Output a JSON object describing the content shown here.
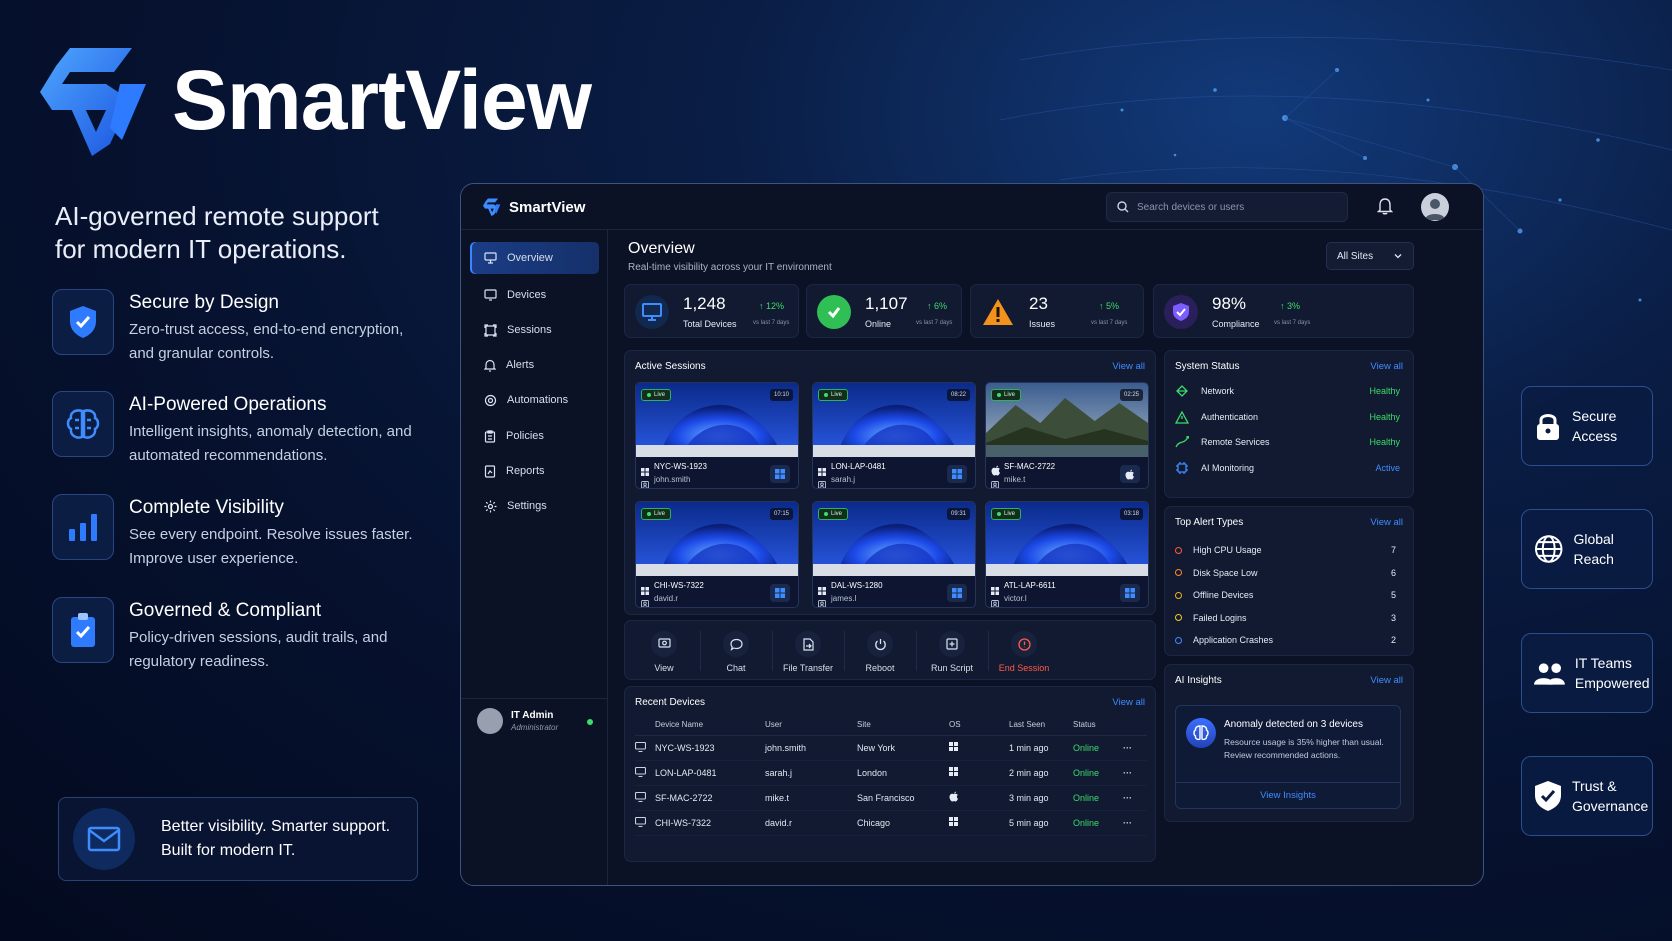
{
  "brand": {
    "name": "SmartView",
    "tagline": "AI-governed remote support for modern IT operations."
  },
  "features": [
    {
      "title": "Secure by Design",
      "desc": "Zero-trust access, end-to-end encryption, and granular controls.",
      "icon": "shield-check-icon"
    },
    {
      "title": "AI-Powered Operations",
      "desc": "Intelligent insights, anomaly detection, and automated recommendations.",
      "icon": "brain-icon"
    },
    {
      "title": "Complete Visibility",
      "desc": "See every endpoint. Resolve issues faster. Improve user experience.",
      "icon": "bar-chart-icon"
    },
    {
      "title": "Governed & Compliant",
      "desc": "Policy-driven sessions, audit trails, and regulatory readiness.",
      "icon": "clipboard-check-icon"
    }
  ],
  "footer": {
    "line1": "Better visibility. Smarter support.",
    "line2": "Built for modern IT."
  },
  "side_cards": [
    {
      "line1": "Secure",
      "line2": "Access",
      "icon": "lock-icon"
    },
    {
      "line1": "Global",
      "line2": "Reach",
      "icon": "globe-icon"
    },
    {
      "line1": "IT Teams",
      "line2": "Empowered",
      "icon": "users-icon"
    },
    {
      "line1": "Trust &",
      "line2": "Governance",
      "icon": "shield-check-icon"
    }
  ],
  "app": {
    "name": "SmartView",
    "search_placeholder": "Search devices or users",
    "nav": [
      {
        "label": "Overview",
        "icon": "monitor-icon",
        "active": true
      },
      {
        "label": "Devices",
        "icon": "devices-icon"
      },
      {
        "label": "Sessions",
        "icon": "sessions-icon"
      },
      {
        "label": "Alerts",
        "icon": "bell-icon"
      },
      {
        "label": "Automations",
        "icon": "gear-icon"
      },
      {
        "label": "Policies",
        "icon": "clipboard-icon"
      },
      {
        "label": "Reports",
        "icon": "report-icon"
      },
      {
        "label": "Settings",
        "icon": "settings-icon"
      }
    ],
    "user": {
      "name": "IT Admin",
      "role": "Administrator"
    },
    "overview": {
      "title": "Overview",
      "subtitle": "Real-time visibility across your IT environment",
      "site_filter": "All Sites"
    },
    "stats": [
      {
        "value": "1,248",
        "label": "Total Devices",
        "change": "↑ 12%",
        "vs": "vs last 7 days",
        "color": "#2f7bff"
      },
      {
        "value": "1,107",
        "label": "Online",
        "change": "↑ 6%",
        "vs": "vs last 7 days",
        "color": "#2fbf55"
      },
      {
        "value": "23",
        "label": "Issues",
        "change": "↑ 5%",
        "vs": "vs last 7 days",
        "color": "#f2921c"
      },
      {
        "value": "98%",
        "label": "Compliance",
        "change": "↑ 3%",
        "vs": "vs last 7 days",
        "color": "#7b5cff"
      }
    ],
    "active_sessions": {
      "title": "Active Sessions",
      "view_all": "View all",
      "live_label": "Live",
      "sessions": [
        {
          "host": "NYC-WS-1923",
          "user": "john.smith",
          "time": "10:10",
          "os": "windows"
        },
        {
          "host": "LON-LAP-0481",
          "user": "sarah.j",
          "time": "08:22",
          "os": "windows"
        },
        {
          "host": "SF-MAC-2722",
          "user": "mike.t",
          "time": "02:25",
          "os": "mac"
        },
        {
          "host": "CHI-WS-7322",
          "user": "david.r",
          "time": "07:15",
          "os": "windows"
        },
        {
          "host": "DAL-WS-1280",
          "user": "james.l",
          "time": "09:31",
          "os": "windows"
        },
        {
          "host": "ATL-LAP-6611",
          "user": "victor.l",
          "time": "03:18",
          "os": "windows"
        }
      ]
    },
    "actions": [
      {
        "label": "View",
        "icon": "screen-icon"
      },
      {
        "label": "Chat",
        "icon": "chat-icon"
      },
      {
        "label": "File Transfer",
        "icon": "file-transfer-icon"
      },
      {
        "label": "Reboot",
        "icon": "power-icon"
      },
      {
        "label": "Run Script",
        "icon": "script-icon"
      },
      {
        "label": "End Session",
        "icon": "stop-icon",
        "danger": true
      }
    ],
    "recent_devices": {
      "title": "Recent Devices",
      "view_all": "View all",
      "columns": [
        "Device Name",
        "User",
        "Site",
        "OS",
        "Last Seen",
        "Status"
      ],
      "rows": [
        {
          "name": "NYC-WS-1923",
          "user": "john.smith",
          "site": "New York",
          "os": "windows",
          "last_seen": "1 min ago",
          "status": "Online"
        },
        {
          "name": "LON-LAP-0481",
          "user": "sarah.j",
          "site": "London",
          "os": "windows",
          "last_seen": "2 min ago",
          "status": "Online"
        },
        {
          "name": "SF-MAC-2722",
          "user": "mike.t",
          "site": "San Francisco",
          "os": "mac",
          "last_seen": "3 min ago",
          "status": "Online"
        },
        {
          "name": "CHI-WS-7322",
          "user": "david.r",
          "site": "Chicago",
          "os": "windows",
          "last_seen": "5 min ago",
          "status": "Online"
        }
      ]
    },
    "system_status": {
      "title": "System Status",
      "view_all": "View all",
      "items": [
        {
          "label": "Network",
          "value": "Healthy",
          "icon": "network-icon"
        },
        {
          "label": "Authentication",
          "value": "Healthy",
          "icon": "auth-icon"
        },
        {
          "label": "Remote Services",
          "value": "Healthy",
          "icon": "remote-icon"
        },
        {
          "label": "AI Monitoring",
          "value": "Active",
          "icon": "ai-icon"
        }
      ]
    },
    "top_alerts": {
      "title": "Top Alert Types",
      "view_all": "View all",
      "items": [
        {
          "label": "High CPU Usage",
          "count": "7",
          "color": "#ff5a3c"
        },
        {
          "label": "Disk Space Low",
          "count": "6",
          "color": "#ff8a2a"
        },
        {
          "label": "Offline Devices",
          "count": "5",
          "color": "#f2b21c"
        },
        {
          "label": "Failed Logins",
          "count": "3",
          "color": "#f2d01c"
        },
        {
          "label": "Application Crashes",
          "count": "2",
          "color": "#3f8cff"
        }
      ]
    },
    "ai_insights": {
      "title": "AI Insights",
      "view_all": "View all",
      "headline": "Anomaly detected on 3 devices",
      "desc": "Resource usage is 35% higher than usual. Review recommended actions.",
      "button": "View Insights"
    }
  }
}
